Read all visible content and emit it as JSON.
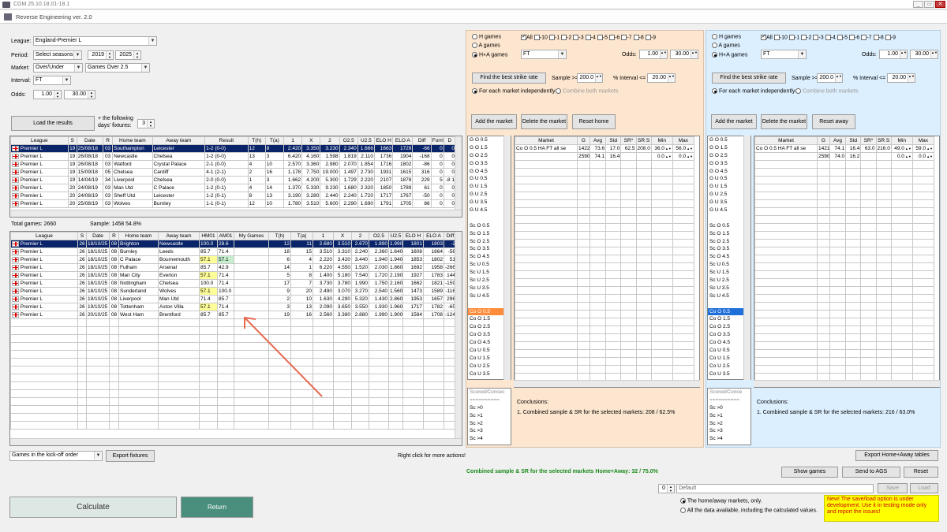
{
  "window": {
    "title": "CGM 25.10.18.01-18.1",
    "subtitle": "Reverse Engineering ver. 2.0"
  },
  "left": {
    "league_label": "League:",
    "league_value": "England-Premier L",
    "period_label": "Period:",
    "period_value": "Select seasons",
    "year_from": "2019",
    "year_to": "2025",
    "market_label": "Market:",
    "market_value": "Over/Under",
    "market_sub": "Games Over 2.5",
    "interval_label": "Interval:",
    "interval_value": "FT",
    "odds_label": "Odds:",
    "odds_min": "1.00",
    "odds_max": "30.00",
    "load_button": "Load the results",
    "following_label": "+ the following days' fixtures:",
    "following_value": "3",
    "total_games": "Total games: 2660",
    "sample": "Sample: 1458  54.8%",
    "kickoff_order": "Games in the kick-off order",
    "export_fixtures": "Export fixtures",
    "right_click": "Right click for more actions!",
    "calculate": "Calculate",
    "return": "Return"
  },
  "hist": {
    "headers": [
      "League",
      "S",
      "Date",
      "R",
      "Home team",
      "Away team",
      "Result",
      "T(h)",
      "T(a)",
      "1",
      "X",
      "2",
      "O2.5",
      "U2.5",
      "ELO H",
      "ELO A",
      "Diff",
      "Form",
      "D"
    ],
    "rows": [
      [
        "Premier L",
        "19",
        "25/08/18",
        "03",
        "Southampton",
        "Leicester",
        "1-2 (0-0)",
        "12",
        "8",
        "2.420",
        "3.350",
        "3.230",
        "2.340",
        "1.666",
        "1663",
        "1729",
        "-66",
        "0",
        "0"
      ],
      [
        "Premier L",
        "19",
        "26/08/18",
        "03",
        "Newcastle",
        "Chelsea",
        "1-2 (0-0)",
        "13",
        "3",
        "6.420",
        "4.160",
        "1.598",
        "1.819",
        "2.110",
        "1736",
        "1904",
        "-168",
        "0",
        "0"
      ],
      [
        "Premier L",
        "19",
        "26/08/18",
        "03",
        "Watford",
        "Crystal Palace",
        "2-1 (0-0)",
        "4",
        "10",
        "2.570",
        "3.360",
        "2.980",
        "2.070",
        "1.854",
        "1716",
        "1802",
        "-86",
        "0",
        "0"
      ],
      [
        "Premier L",
        "19",
        "15/09/18",
        "05",
        "Chelsea",
        "Cardiff",
        "4-1 (2-1)",
        "2",
        "16",
        "1.178",
        "7.750",
        "19.000",
        "1.497",
        "2.730",
        "1931",
        "1615",
        "316",
        "0",
        "0"
      ],
      [
        "Premier L",
        "19",
        "14/04/19",
        "34",
        "Liverpool",
        "Chelsea",
        "2-0 (0-0)",
        "1",
        "3",
        "1.662",
        "4.200",
        "5.300",
        "1.729",
        "2.220",
        "2107",
        "1878",
        "229",
        "5",
        "-8 1"
      ],
      [
        "Premier L",
        "20",
        "24/08/19",
        "03",
        "Man Utd",
        "C Palace",
        "1-2 (0-1)",
        "4",
        "14",
        "1.370",
        "5.330",
        "9.230",
        "1.680",
        "2.320",
        "1850",
        "1789",
        "61",
        "0",
        "0"
      ],
      [
        "Premier L",
        "20",
        "24/08/19",
        "03",
        "Sheff Utd",
        "Leicester",
        "1-2 (0-1)",
        "8",
        "13",
        "3.190",
        "3.280",
        "2.440",
        "2.240",
        "1.720",
        "1717",
        "1767",
        "-50",
        "0",
        "0"
      ],
      [
        "Premier L",
        "20",
        "25/08/19",
        "03",
        "Wolves",
        "Burnley",
        "1-1 (0-1)",
        "12",
        "10",
        "1.780",
        "3.510",
        "5.600",
        "2.290",
        "1.690",
        "1791",
        "1705",
        "86",
        "0",
        "0"
      ]
    ]
  },
  "fix": {
    "headers": [
      "League",
      "S",
      "Date",
      "R",
      "Home team",
      "Away team",
      "HM01",
      "AM01",
      "My Games",
      "T(h)",
      "T(a)",
      "1",
      "X",
      "2",
      "O2.5",
      "U2.5",
      "ELO H",
      "ELO A",
      "Diff"
    ],
    "rows": [
      [
        "Premier L",
        "26",
        "18/10/25",
        "08",
        "Brighton",
        "Newcastle",
        "100.0",
        "28.6",
        "",
        "12",
        "11",
        "2.680",
        "3.510",
        "2.670",
        "1.890",
        "1.990",
        "1801",
        "1803",
        "-2"
      ],
      [
        "Premier L",
        "26",
        "18/10/25",
        "08",
        "Burnley",
        "Leeds",
        "85.7",
        "71.4",
        "",
        "18",
        "15",
        "3.510",
        "3.310",
        "2.240",
        "2.360",
        "1.640",
        "1608",
        "1664",
        "-56"
      ],
      [
        "Premier L",
        "26",
        "18/10/25",
        "08",
        "C Palace",
        "Bournemouth",
        "57.1",
        "57.1",
        "",
        "6",
        "4",
        "2.220",
        "3.420",
        "3.440",
        "1.940",
        "1.940",
        "1853",
        "1802",
        "51"
      ],
      [
        "Premier L",
        "26",
        "18/10/25",
        "08",
        "Fulham",
        "Arsenal",
        "85.7",
        "42.9",
        "",
        "14",
        "1",
        "6.220",
        "4.550",
        "1.520",
        "2.030",
        "1.860",
        "1692",
        "1958",
        "-266"
      ],
      [
        "Premier L",
        "26",
        "18/10/25",
        "08",
        "Man City",
        "Everton",
        "57.1",
        "71.4",
        "",
        "5",
        "8",
        "1.400",
        "5.180",
        "7.540",
        "1.720",
        "2.190",
        "1927",
        "1783",
        "144"
      ],
      [
        "Premier L",
        "26",
        "18/10/25",
        "08",
        "Nottingham",
        "Chelsea",
        "100.0",
        "71.4",
        "",
        "17",
        "7",
        "3.730",
        "3.780",
        "1.990",
        "1.750",
        "2.160",
        "1662",
        "1821",
        "-159"
      ],
      [
        "Premier L",
        "26",
        "18/10/25",
        "08",
        "Sunderland",
        "Wolves",
        "57.1",
        "100.0",
        "",
        "9",
        "20",
        "2.490",
        "3.070",
        "3.270",
        "2.540",
        "1.560",
        "1473",
        "1589",
        "-116"
      ],
      [
        "Premier L",
        "26",
        "19/10/25",
        "08",
        "Liverpool",
        "Man Utd",
        "71.4",
        "85.7",
        "",
        "2",
        "10",
        "1.630",
        "4.290",
        "5.320",
        "1.430",
        "2.860",
        "1953",
        "1657",
        "296"
      ],
      [
        "Premier L",
        "26",
        "19/10/25",
        "08",
        "Tottenham",
        "Aston Villa",
        "57.1",
        "71.4",
        "",
        "3",
        "13",
        "2.090",
        "3.650",
        "3.550",
        "1.930",
        "1.960",
        "1717",
        "1782",
        "-65"
      ],
      [
        "Premier L",
        "26",
        "20/10/25",
        "08",
        "West Ham",
        "Brentford",
        "85.7",
        "85.7",
        "",
        "19",
        "16",
        "2.560",
        "3.380",
        "2.880",
        "1.990",
        "1.900",
        "1584",
        "1708",
        "-124"
      ]
    ]
  },
  "home": {
    "h_games": "H games",
    "a_games": "A games",
    "ha_games": "H+A games",
    "all": "All",
    "deltas": [
      "-10",
      "-1",
      "-2",
      "-3",
      "-4",
      "-5",
      "-6",
      "-7",
      "-8",
      "-9"
    ],
    "interval": "FT",
    "odds_label": "Odds:",
    "odds_min": "1.00",
    "odds_max": "30.00",
    "find_button": "Find the best strike rate",
    "sample_label": "Sample >=",
    "sample_value": "200.0",
    "pct_label": "% Interval <=",
    "pct_value": "20.00",
    "each_market": "For each market independently",
    "combine": "Combine both markets",
    "add": "Add the market",
    "delete": "Delete the market",
    "reset": "Reset home",
    "markets": [
      "G O 0.5",
      "G O 1.5",
      "G O 2.5",
      "G O 3.5",
      "G O 4.5",
      "G U 0.5",
      "G U 1.5",
      "G U 2.5",
      "G U 3.5",
      "G U 4.5",
      "",
      "Sc O 0.5",
      "Sc O 1.5",
      "Sc O 2.5",
      "Sc O 3.5",
      "Sc O 4.5",
      "Sc U 0.5",
      "Sc U 1.5",
      "Sc U 2.5",
      "Sc U 3.5",
      "Sc U 4.5",
      "",
      "Co O 0.5",
      "Co O 1.5",
      "Co O 2.5",
      "Co O 3.5",
      "Co O 4.5",
      "Co U 0.5",
      "Co U 1.5",
      "Co U 2.5",
      "Co U 3.5",
      "Co U 4.5"
    ],
    "highlight": "Co O 0.5",
    "bottom_list": [
      "Scored/Concec",
      "==========",
      "Sc >0",
      "Sc >1",
      "Sc >2",
      "Sc >3",
      "Sc >4"
    ],
    "table_headers": [
      "Market",
      "G",
      "Avg",
      "Std",
      "SR*",
      "SR S",
      "Min",
      "Max"
    ],
    "rows": [
      [
        "Co O 0.5 HA FT all se",
        "1422",
        "73.6",
        "17.0",
        "62.5",
        "208.0",
        "36.0",
        "56.0"
      ],
      [
        "",
        "2590",
        "74.1",
        "16.4",
        "",
        "",
        "0.0",
        "0.0"
      ]
    ],
    "conclusions": "Conclusions:",
    "conclusion_line": "1. Combined sample & SR for the selected markets:",
    "conclusion_value": "208 / 62.5%"
  },
  "away": {
    "h_games": "H games",
    "a_games": "A games",
    "ha_games": "H+A games",
    "all": "All",
    "deltas": [
      "-10",
      "-1",
      "-2",
      "-3",
      "-4",
      "-5",
      "-6",
      "-7",
      "-8",
      "-9"
    ],
    "interval": "FT",
    "odds_label": "Odds:",
    "odds_min": "1.00",
    "odds_max": "30.00",
    "find_button": "Find the best strike rate",
    "sample_label": "Sample >=",
    "sample_value": "200.0",
    "pct_label": "% Interval <=",
    "pct_value": "20.00",
    "each_market": "For each market independently",
    "combine": "Combine both markets",
    "add": "Add the market",
    "delete": "Delete the market",
    "reset": "Reset away",
    "markets": [
      "G O 0.5",
      "G O 1.5",
      "G O 2.5",
      "G O 3.5",
      "G O 4.5",
      "G U 0.5",
      "G U 1.5",
      "G U 2.5",
      "G U 3.5",
      "G U 4.5",
      "",
      "Sc O 0.5",
      "Sc O 1.5",
      "Sc O 2.5",
      "Sc O 3.5",
      "Sc O 4.5",
      "Sc U 0.5",
      "Sc U 1.5",
      "Sc U 2.5",
      "Sc U 3.5",
      "Sc U 4.5",
      "",
      "Co O 0.5",
      "Co O 1.5",
      "Co O 2.5",
      "Co O 3.5",
      "Co O 4.5",
      "Co U 0.5",
      "Co U 1.5",
      "Co U 2.5",
      "Co U 3.5",
      "Co U 4.5"
    ],
    "highlight": "Co O 0.5",
    "bottom_list": [
      "Scored/Conce",
      "==========",
      "Sc >0",
      "Sc >1",
      "Sc >2",
      "Sc >3",
      "Sc >4"
    ],
    "table_headers": [
      "Market",
      "G",
      "Avg",
      "Std",
      "SR*",
      "SR S",
      "Min",
      "Max"
    ],
    "rows": [
      [
        "Co O 0.5 HA FT all se",
        "1421",
        "74.1",
        "16.4",
        "63.0",
        "216.0",
        "49.0",
        "59.0"
      ],
      [
        "",
        "2590",
        "74.0",
        "16.2",
        "",
        "",
        "0.0",
        "0.0"
      ]
    ],
    "conclusions": "Conclusions:",
    "conclusion_line": "1. Combined sample & SR for the selected markets:",
    "conclusion_value": "216 / 63.0%"
  },
  "bottom": {
    "combined": "Combined sample & SR for the selected markets Home+Away:  32 / 75.0%",
    "show_games": "Show games",
    "send_ags": "Send to AGS",
    "reset": "Reset",
    "export_ha": "Export Home+Away tables",
    "counter": "0",
    "default": "Default",
    "save": "Save",
    "load": "Load",
    "opt1": "The home/away markets, only.",
    "opt2": "All the data available, including the calculated values.",
    "notice": "New!  The save/load option is under development. Use it in testing mode only and report the issues!"
  }
}
